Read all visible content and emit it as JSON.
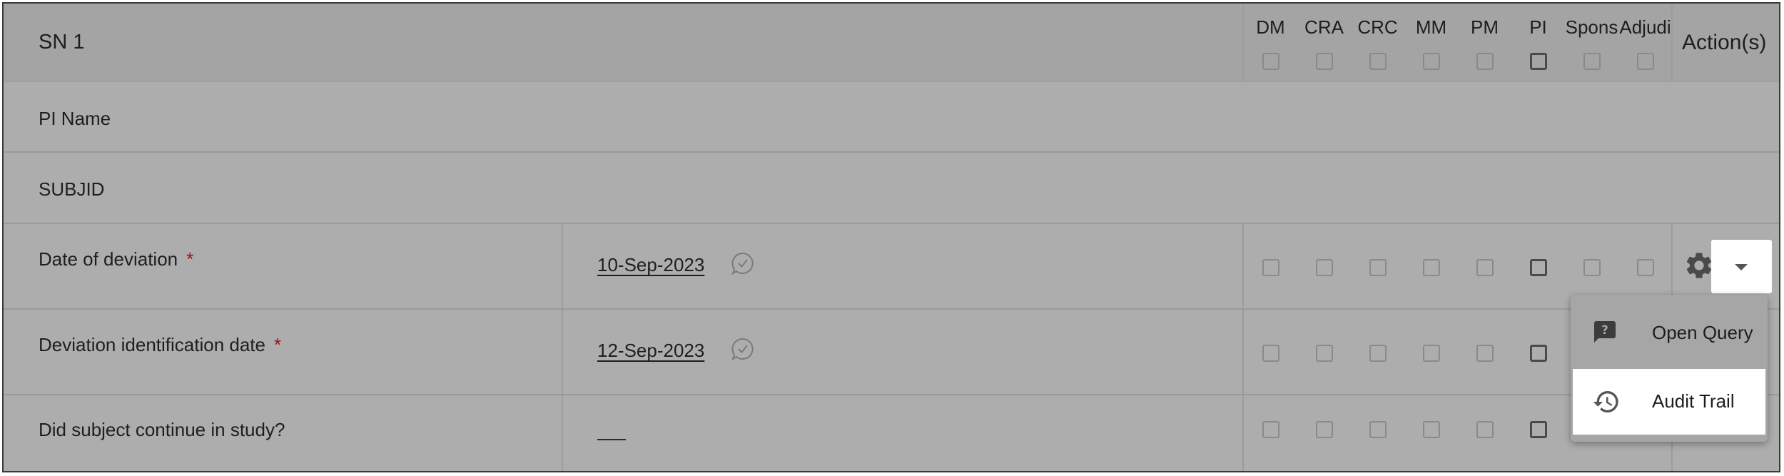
{
  "header": {
    "section": "SN 1",
    "roles": [
      "DM",
      "CRA",
      "CRC",
      "MM",
      "PM",
      "PI",
      "Spons",
      "Adjudi"
    ],
    "actions": "Action(s)"
  },
  "rows": [
    {
      "label": "PI Name"
    },
    {
      "label": "SUBJID"
    },
    {
      "label": "Date of deviation",
      "required": "*",
      "value": "10-Sep-2023"
    },
    {
      "label": "Deviation identification date",
      "required": "*",
      "value": "12-Sep-2023"
    },
    {
      "label": "Did subject continue in study?"
    }
  ],
  "menu": {
    "items": [
      {
        "label": "Open Query",
        "icon": "question-comment-icon"
      },
      {
        "label": "Audit Trail",
        "icon": "history-icon"
      }
    ],
    "selected": "Audit Trail"
  },
  "colors": {
    "overlay": "#adadad",
    "required": "#a01010",
    "menu_selected": "#ffffff"
  }
}
